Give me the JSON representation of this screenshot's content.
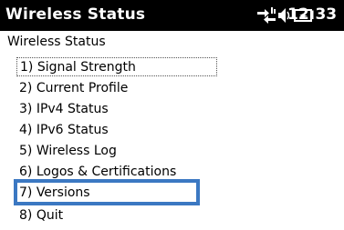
{
  "titlebar": {
    "app_title": "Wireless Status",
    "clock": "12:33",
    "icons": [
      "network-sync-icon",
      "speaker-icon",
      "battery-charging-icon"
    ]
  },
  "screen": {
    "header": "Wireless Status"
  },
  "menu": {
    "items": [
      {
        "label": "1) Signal Strength",
        "focused": true
      },
      {
        "label": "2) Current Profile",
        "focused": false
      },
      {
        "label": "3) IPv4 Status",
        "focused": false
      },
      {
        "label": "4) IPv6 Status",
        "focused": false
      },
      {
        "label": "5) Wireless Log",
        "focused": false
      },
      {
        "label": "6) Logos & Certifications",
        "focused": false
      },
      {
        "label": "7) Versions",
        "focused": false,
        "highlighted": true
      },
      {
        "label": "8) Quit",
        "focused": false
      }
    ]
  },
  "colors": {
    "titlebar_bg": "#000000",
    "highlight_border": "#3b78c2"
  }
}
